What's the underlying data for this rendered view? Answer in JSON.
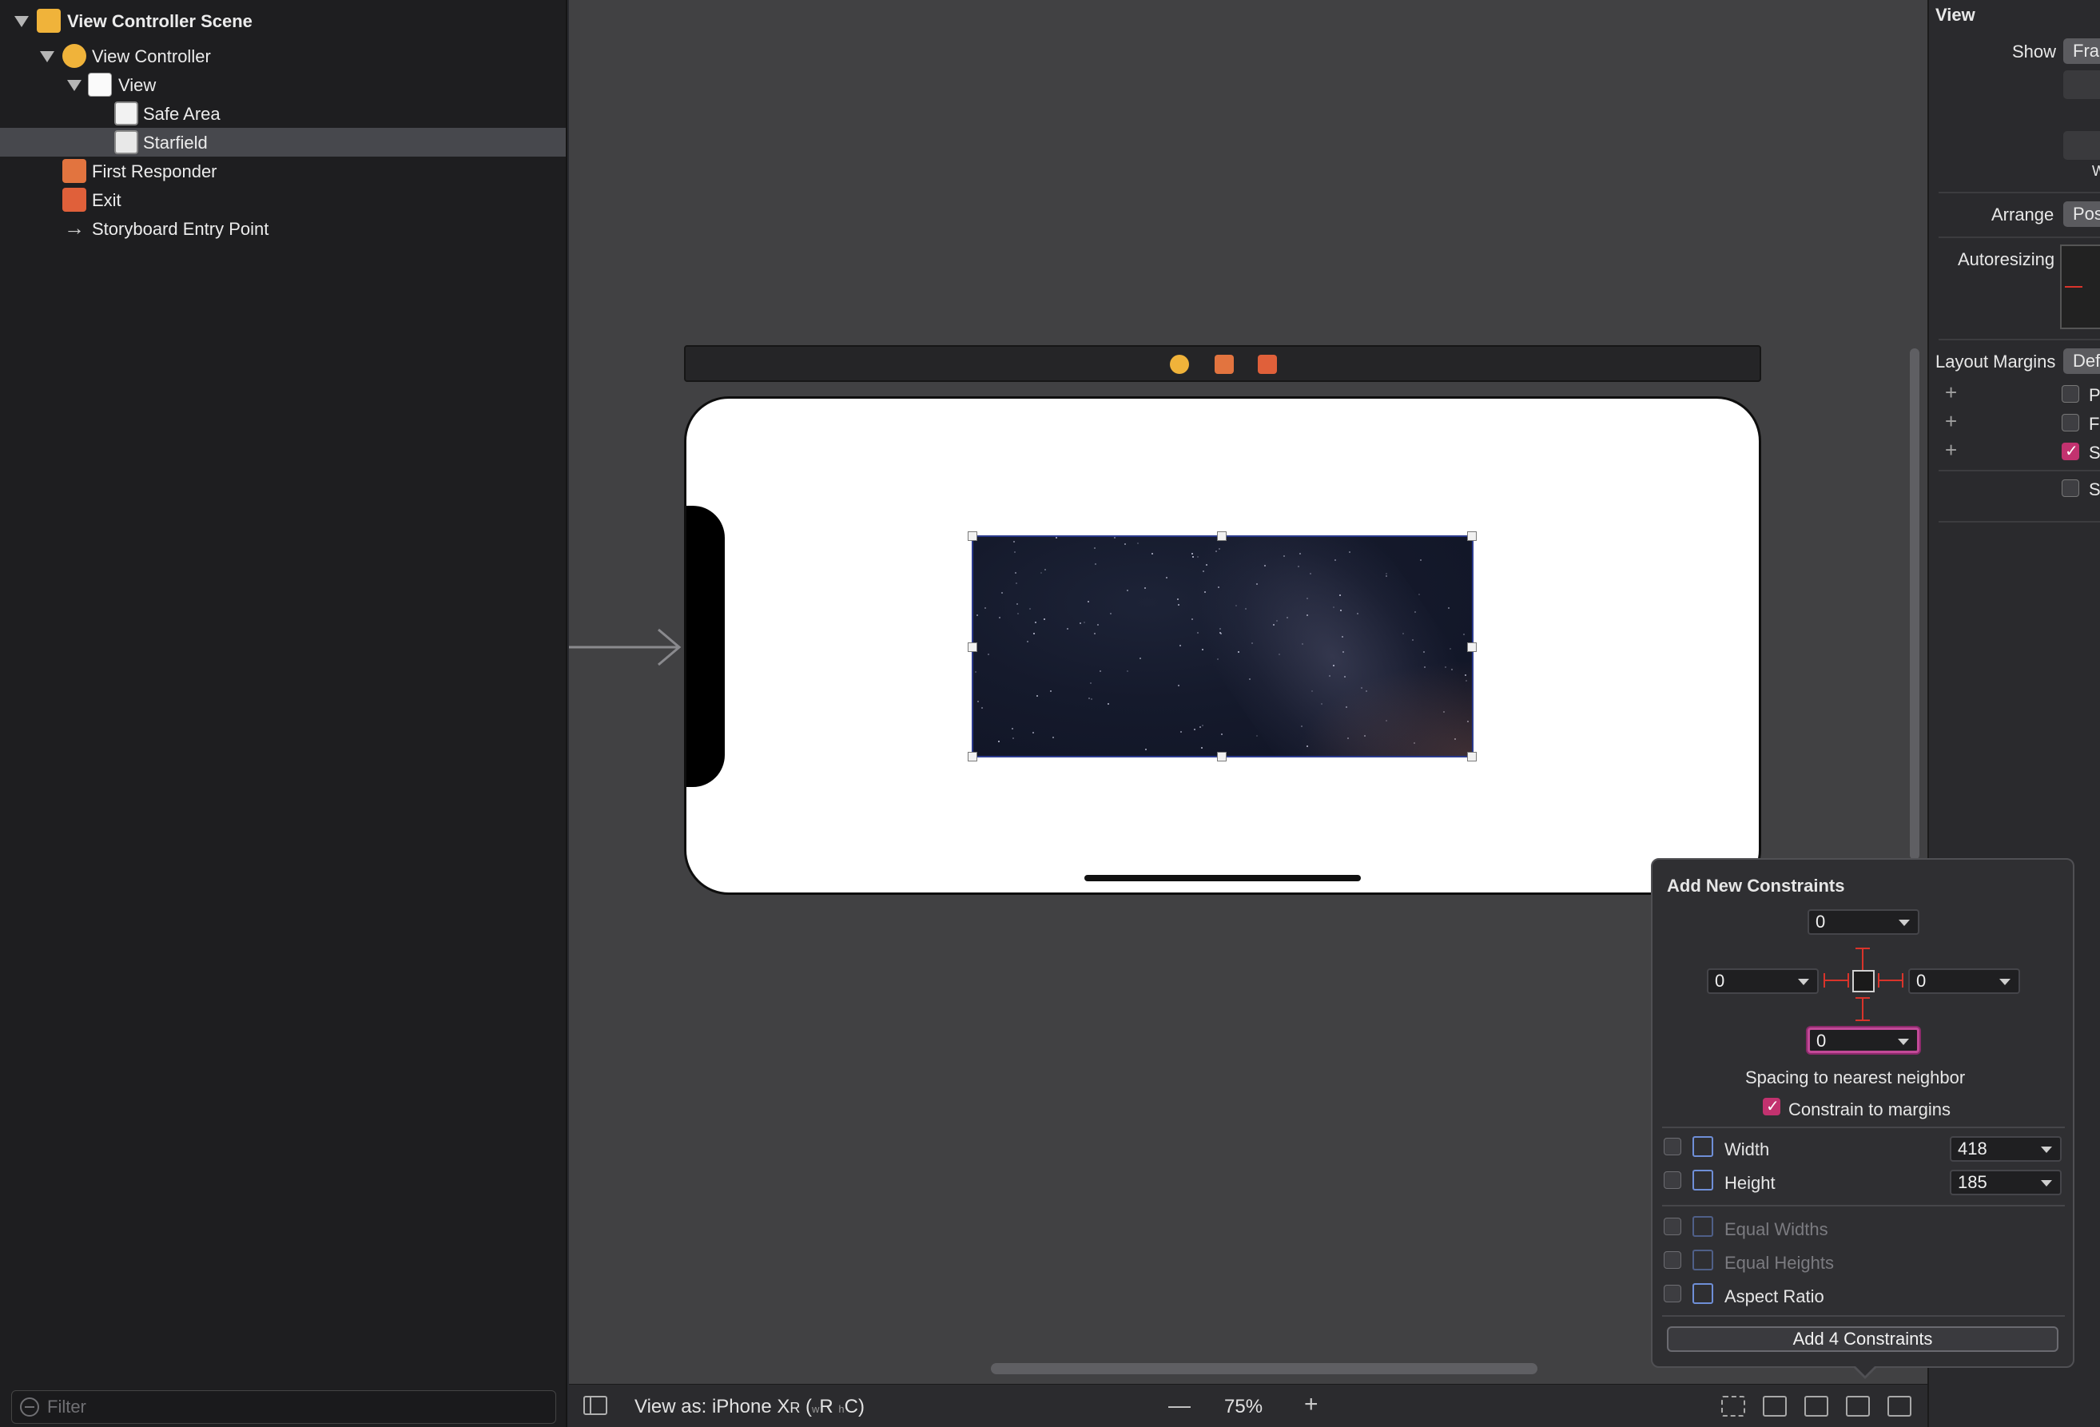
{
  "outline": {
    "items": [
      {
        "label": "View Controller Scene"
      },
      {
        "label": "View Controller"
      },
      {
        "label": "View"
      },
      {
        "label": "Safe Area"
      },
      {
        "label": "Starfield"
      },
      {
        "label": "First Responder"
      },
      {
        "label": "Exit"
      },
      {
        "label": "Storyboard Entry Point"
      }
    ],
    "filter_placeholder": "Filter"
  },
  "canvas": {
    "selected_view": "Starfield"
  },
  "bottom_bar": {
    "view_as_prefix": "View as: iPhone X",
    "view_as_r": "R",
    "view_as_paren_open": " (",
    "view_as_w": "w",
    "view_as_wr": "R ",
    "view_as_h": "h",
    "view_as_hc": "C)",
    "zoom_minus": "—",
    "zoom": "75%",
    "zoom_plus": "+"
  },
  "inspector": {
    "section": "View",
    "show_label": "Show",
    "show_value": "Fra",
    "w_fragment": "W",
    "arrange_label": "Arrange",
    "arrange_value": "Pos",
    "autoresizing_label": "Autoresizing",
    "layout_margins_label": "Layout Margins",
    "layout_margins_value": "Def",
    "options": [
      {
        "label": "P",
        "checked": false
      },
      {
        "label": "F",
        "checked": false
      },
      {
        "label": "S",
        "checked": true
      },
      {
        "label": "S",
        "checked": false
      }
    ]
  },
  "popover": {
    "title": "Add New Constraints",
    "top": "0",
    "leading": "0",
    "trailing": "0",
    "bottom": "0",
    "spacing_label": "Spacing to nearest neighbor",
    "constrain_to_margins": "Constrain to margins",
    "width_label": "Width",
    "width_value": "418",
    "height_label": "Height",
    "height_value": "185",
    "equal_widths": "Equal Widths",
    "equal_heights": "Equal Heights",
    "aspect_ratio": "Aspect Ratio",
    "add_button": "Add 4 Constraints"
  }
}
